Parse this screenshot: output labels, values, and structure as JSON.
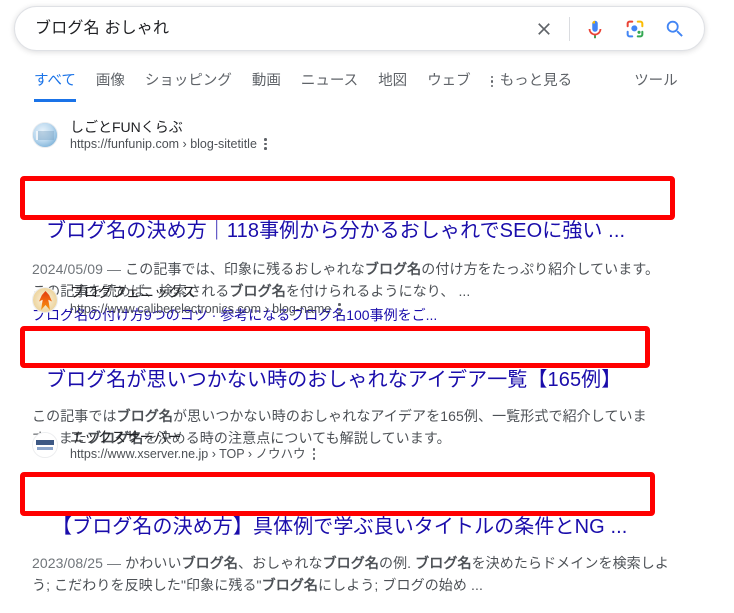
{
  "search": {
    "query": "ブログ名 おしゃれ",
    "clear_icon": "close-icon",
    "voice_icon": "microphone-icon",
    "lens_icon": "google-lens-icon",
    "submit_icon": "search-icon"
  },
  "tabs": [
    {
      "label": "すべて",
      "active": true
    },
    {
      "label": "画像",
      "active": false
    },
    {
      "label": "ショッピング",
      "active": false
    },
    {
      "label": "動画",
      "active": false
    },
    {
      "label": "ニュース",
      "active": false
    },
    {
      "label": "地図",
      "active": false
    },
    {
      "label": "ウェブ",
      "active": false
    },
    {
      "label": "もっと見る",
      "active": false
    }
  ],
  "tools_label": "ツール",
  "results": [
    {
      "site_name": "しごとFUNくらぶ",
      "url": "https://funfunip.com › blog-sitetitle",
      "title": "ブログ名の決め方｜118事例から分かるおしゃれでSEOに強い ...",
      "snippet_date": "2024/05/09 —",
      "snippet_parts": [
        {
          "text": " この記事では、印象に残るおしゃれな",
          "bold": false
        },
        {
          "text": "ブログ名",
          "bold": true
        },
        {
          "text": "の付け方をたっぷり紹介しています。 この記事を読めば、検索される",
          "bold": false
        },
        {
          "text": "ブログ名",
          "bold": true
        },
        {
          "text": "を付けられるようになり、 ...",
          "bold": false
        }
      ],
      "sitelinks": "ブログ名の付け方9つのコツ · 参考になるブログ名100事例をご..."
    },
    {
      "site_name": "ブログフェニックス",
      "url": "https://www.caliberelectronics.com › blog-name",
      "title": "ブログ名が思いつかない時のおしゃれなアイデア一覧【165例】",
      "snippet_date": "",
      "snippet_parts": [
        {
          "text": "この記事では",
          "bold": false
        },
        {
          "text": "ブログ名",
          "bold": true
        },
        {
          "text": "が思いつかない時のおしゃれなアイデアを165例、一覧形式で紹介しています。また",
          "bold": false
        },
        {
          "text": "ブログ名",
          "bold": true
        },
        {
          "text": "を決める時の注意点についても解説しています。",
          "bold": false
        }
      ],
      "sitelinks": ""
    },
    {
      "site_name": "エックスサーバー",
      "url": "https://www.xserver.ne.jp › TOP › ノウハウ",
      "title": "【ブログ名の決め方】具体例で学ぶ良いタイトルの条件とNG ...",
      "snippet_date": "2023/08/25 —",
      "snippet_parts": [
        {
          "text": " かわいい",
          "bold": false
        },
        {
          "text": "ブログ名",
          "bold": true
        },
        {
          "text": "、おしゃれな",
          "bold": false
        },
        {
          "text": "ブログ名",
          "bold": true
        },
        {
          "text": "の例. ",
          "bold": false
        },
        {
          "text": "ブログ名",
          "bold": true
        },
        {
          "text": "を決めたらドメインを検索しよう; こだわりを反映した\"印象に残る\"",
          "bold": false
        },
        {
          "text": "ブログ名",
          "bold": true
        },
        {
          "text": "にしよう; ブログの始め ...",
          "bold": false
        }
      ],
      "sitelinks": ""
    }
  ],
  "colors": {
    "link": "#1a0dab",
    "accent": "#1a73e8",
    "highlight_box": "#ff0000",
    "snippet_text": "#4d5156"
  }
}
